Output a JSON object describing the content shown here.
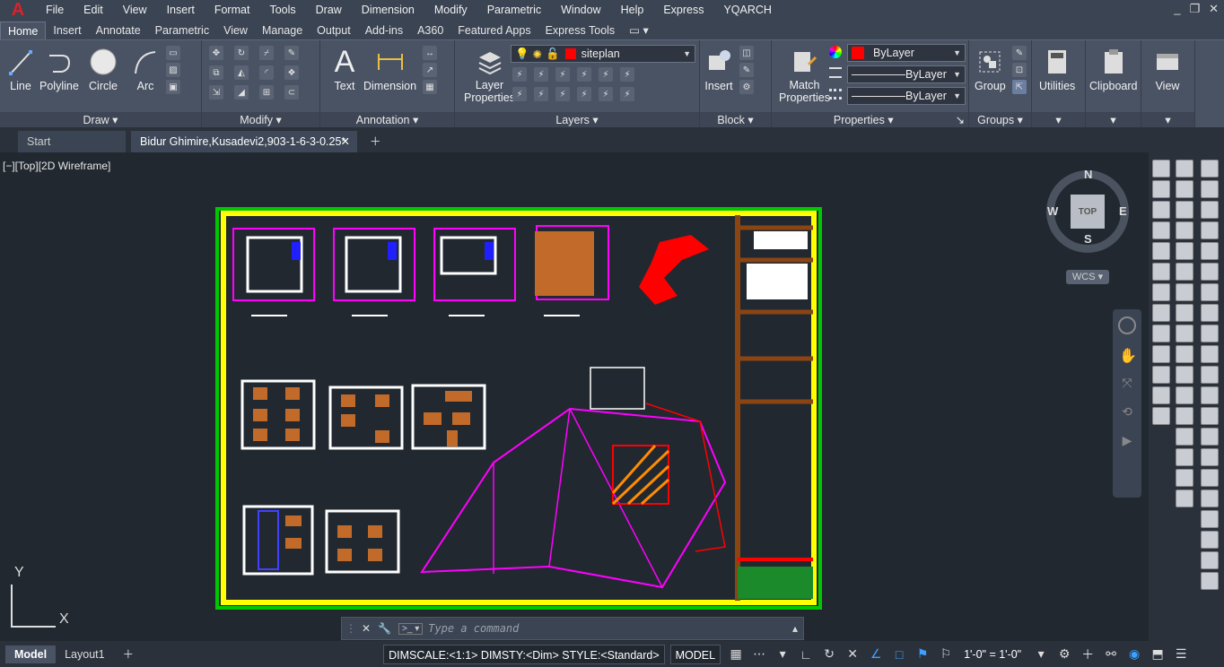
{
  "menu": [
    "File",
    "Edit",
    "View",
    "Insert",
    "Format",
    "Tools",
    "Draw",
    "Dimension",
    "Modify",
    "Parametric",
    "Window",
    "Help",
    "Express",
    "YQARCH"
  ],
  "ribbon_tabs": [
    "Home",
    "Insert",
    "Annotate",
    "Parametric",
    "View",
    "Manage",
    "Output",
    "Add-ins",
    "A360",
    "Featured Apps",
    "Express Tools"
  ],
  "active_tab": "Home",
  "panels": {
    "draw": {
      "title": "Draw",
      "buttons": [
        "Line",
        "Polyline",
        "Circle",
        "Arc"
      ]
    },
    "modify": {
      "title": "Modify"
    },
    "annotation": {
      "title": "Annotation",
      "buttons": [
        "Text",
        "Dimension"
      ]
    },
    "layers": {
      "title": "Layers",
      "layer_properties": "Layer\nProperties",
      "layer_properties_l1": "Layer",
      "layer_properties_l2": "Properties",
      "current_layer": "siteplan"
    },
    "block": {
      "title": "Block",
      "insert": "Insert"
    },
    "properties": {
      "title": "Properties",
      "match_l1": "Match",
      "match_l2": "Properties",
      "color": "ByLayer",
      "linetype": "ByLayer",
      "lineweight": "ByLayer"
    },
    "groups": {
      "title": "Groups",
      "group": "Group"
    },
    "utilities": {
      "label": "Utilities"
    },
    "clipboard": {
      "label": "Clipboard"
    },
    "view": {
      "label": "View"
    }
  },
  "doc_tabs": {
    "start": "Start",
    "active": "Bidur Ghimire,Kusadevi2,903-1-6-3-0.25*"
  },
  "viewport_label": "[−][Top][2D Wireframe]",
  "viewcube": {
    "n": "N",
    "s": "S",
    "e": "E",
    "w": "W",
    "top": "TOP",
    "wcs": "WCS"
  },
  "ucs": {
    "x": "X",
    "y": "Y"
  },
  "command": {
    "placeholder": "Type a command"
  },
  "status": {
    "model_tab": "Model",
    "layout_tab": "Layout1",
    "dimscale": "DIMSCALE:<1:1> DIMSTY:<Dim> STYLE:<Standard>",
    "space": "MODEL",
    "scale": "1'-0\" = 1'-0\""
  },
  "colors": {
    "accent": "#0078d7",
    "frame_yellow": "#ffff00",
    "frame_green": "#00c800",
    "magenta": "#ff00ff",
    "red": "#ff0000"
  }
}
